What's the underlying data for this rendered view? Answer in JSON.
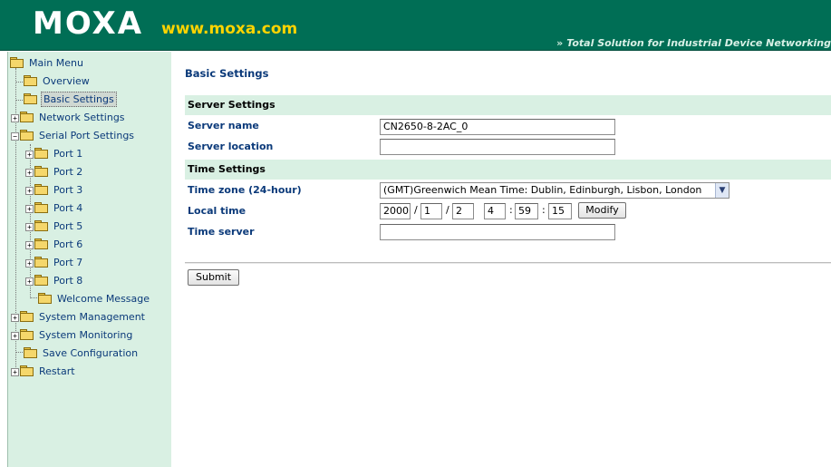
{
  "header": {
    "logo": "MOXA",
    "url": "www.moxa.com",
    "tagline_arrows": "»",
    "tagline": "Total Solution for Industrial Device Networking"
  },
  "sidebar": {
    "items": [
      {
        "label": "Main Menu"
      },
      {
        "label": "Overview"
      },
      {
        "label": "Basic Settings"
      },
      {
        "label": "Network Settings"
      },
      {
        "label": "Serial Port Settings"
      },
      {
        "label": "Port 1"
      },
      {
        "label": "Port 2"
      },
      {
        "label": "Port 3"
      },
      {
        "label": "Port 4"
      },
      {
        "label": "Port 5"
      },
      {
        "label": "Port 6"
      },
      {
        "label": "Port 7"
      },
      {
        "label": "Port 8"
      },
      {
        "label": "Welcome Message"
      },
      {
        "label": "System Management"
      },
      {
        "label": "System Monitoring"
      },
      {
        "label": "Save Configuration"
      },
      {
        "label": "Restart"
      }
    ],
    "selected": "Basic Settings"
  },
  "main": {
    "title": "Basic Settings",
    "server_section": "Server Settings",
    "server_name_label": "Server name",
    "server_name_value": "CN2650-8-2AC_0",
    "server_location_label": "Server location",
    "server_location_value": "",
    "time_section": "Time Settings",
    "time_zone_label": "Time zone (24-hour)",
    "time_zone_value": "(GMT)Greenwich Mean Time: Dublin, Edinburgh, Lisbon, London",
    "local_time_label": "Local time",
    "local_time": {
      "year": "2000",
      "month": "1",
      "day": "2",
      "hour": "4",
      "minute": "59",
      "second": "15",
      "date_sep": "/",
      "time_sep": ":"
    },
    "modify_label": "Modify",
    "time_server_label": "Time server",
    "time_server_value": "",
    "submit_label": "Submit"
  },
  "icons": {
    "tree_folder": "folder-icon",
    "tree_open_folder": "folder-open-icon",
    "expand": "plus-expander-icon",
    "collapse": "minus-expander-icon",
    "dropdown": "chevron-down-icon"
  },
  "colors": {
    "banner": "#006e55",
    "url": "#ffd400",
    "sidebar_bg": "#d9f0e3",
    "link_text": "#0b3a7a"
  }
}
